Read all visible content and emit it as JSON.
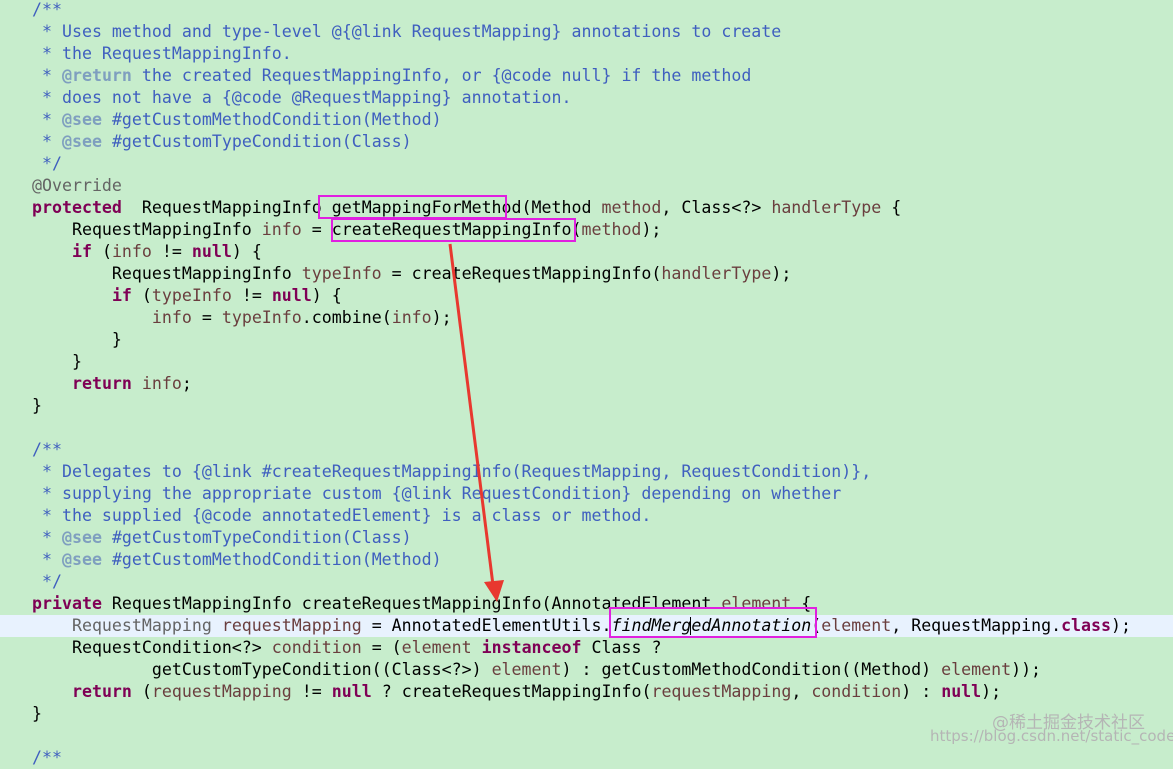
{
  "lines": [
    [
      [
        "c",
        "/**"
      ]
    ],
    [
      [
        "c",
        " * Uses method and type-level @{@link RequestMapping} annotations to create"
      ]
    ],
    [
      [
        "c",
        " * the RequestMappingInfo."
      ]
    ],
    [
      [
        "c",
        " * "
      ],
      [
        "tg",
        "@return"
      ],
      [
        "c",
        " the created RequestMappingInfo, or {@code null} if the method"
      ]
    ],
    [
      [
        "c",
        " * does not have a {@code @RequestMapping} annotation."
      ]
    ],
    [
      [
        "c",
        " * "
      ],
      [
        "tg",
        "@see"
      ],
      [
        "c",
        " #getCustomMethodCondition(Method)"
      ]
    ],
    [
      [
        "c",
        " * "
      ],
      [
        "tg",
        "@see"
      ],
      [
        "c",
        " #getCustomTypeCondition(Class)"
      ]
    ],
    [
      [
        "c",
        " */"
      ]
    ],
    [
      [
        "an",
        "@Override"
      ]
    ],
    [
      [
        "kw",
        "protected"
      ],
      [
        "",
        "  RequestMappingInfo getMappingForMethod(Method "
      ],
      [
        "pm",
        "method"
      ],
      [
        "",
        ", Class<?> "
      ],
      [
        "pm",
        "handlerType"
      ],
      [
        "",
        " {"
      ]
    ],
    [
      [
        "",
        "    RequestMappingInfo "
      ],
      [
        "lv",
        "info"
      ],
      [
        "",
        " = createRequestMappingInfo("
      ],
      [
        "pm",
        "method"
      ],
      [
        "",
        ");"
      ]
    ],
    [
      [
        "",
        "    "
      ],
      [
        "kw",
        "if"
      ],
      [
        "",
        " ("
      ],
      [
        "lv",
        "info"
      ],
      [
        "",
        " != "
      ],
      [
        "kw",
        "null"
      ],
      [
        "",
        ") {"
      ]
    ],
    [
      [
        "",
        "        RequestMappingInfo "
      ],
      [
        "lv",
        "typeInfo"
      ],
      [
        "",
        " = createRequestMappingInfo("
      ],
      [
        "pm",
        "handlerType"
      ],
      [
        "",
        ");"
      ]
    ],
    [
      [
        "",
        "        "
      ],
      [
        "kw",
        "if"
      ],
      [
        "",
        " ("
      ],
      [
        "lv",
        "typeInfo"
      ],
      [
        "",
        " != "
      ],
      [
        "kw",
        "null"
      ],
      [
        "",
        ") {"
      ]
    ],
    [
      [
        "",
        "            "
      ],
      [
        "lv",
        "info"
      ],
      [
        "",
        " = "
      ],
      [
        "lv",
        "typeInfo"
      ],
      [
        "",
        ".combine("
      ],
      [
        "lv",
        "info"
      ],
      [
        "",
        ");"
      ]
    ],
    [
      [
        "",
        "        }"
      ]
    ],
    [
      [
        "",
        "    }"
      ]
    ],
    [
      [
        "",
        "    "
      ],
      [
        "kw",
        "return"
      ],
      [
        "",
        ""
      ],
      [
        "lv",
        " info"
      ],
      [
        "",
        ";"
      ]
    ],
    [
      [
        "",
        "}"
      ]
    ],
    [
      [
        "",
        ""
      ]
    ],
    [
      [
        "c",
        "/**"
      ]
    ],
    [
      [
        "c",
        " * Delegates to {@link #createRequestMappingInfo(RequestMapping, RequestCondition)},"
      ]
    ],
    [
      [
        "c",
        " * supplying the appropriate custom {@link RequestCondition} depending on whether"
      ]
    ],
    [
      [
        "c",
        " * the supplied {@code annotatedElement} is a class or method."
      ]
    ],
    [
      [
        "c",
        " * "
      ],
      [
        "tg",
        "@see"
      ],
      [
        "c",
        " #getCustomTypeCondition(Class)"
      ]
    ],
    [
      [
        "c",
        " * "
      ],
      [
        "tg",
        "@see"
      ],
      [
        "c",
        " #getCustomMethodCondition(Method)"
      ]
    ],
    [
      [
        "c",
        " */"
      ]
    ],
    [
      [
        "kw",
        "private"
      ],
      [
        "",
        " RequestMappingInfo createRequestMappingInfo(AnnotatedElement "
      ],
      [
        "pm",
        "element"
      ],
      [
        "",
        " {"
      ]
    ],
    [
      [
        "an",
        "    RequestMapping "
      ],
      [
        "lv",
        "requestMapping"
      ],
      [
        "",
        " = AnnotatedElementUtils."
      ],
      [
        "it",
        "findMergedAnnotation"
      ],
      [
        "",
        "("
      ],
      [
        "pm",
        "element"
      ],
      [
        "",
        ", RequestMapping."
      ],
      [
        "kw",
        "class"
      ],
      [
        "",
        ");"
      ]
    ],
    [
      [
        "",
        "    RequestCondition<?> "
      ],
      [
        "lv",
        "condition"
      ],
      [
        "",
        " = ("
      ],
      [
        "pm",
        "element"
      ],
      [
        "",
        " "
      ],
      [
        "kw",
        "instanceof"
      ],
      [
        "",
        " Class ?"
      ]
    ],
    [
      [
        "",
        "            getCustomTypeCondition((Class<?>) "
      ],
      [
        "pm",
        "element"
      ],
      [
        "",
        ") : getCustomMethodCondition((Method) "
      ],
      [
        "pm",
        "element"
      ],
      [
        "",
        "));"
      ]
    ],
    [
      [
        "",
        "    "
      ],
      [
        "kw",
        "return"
      ],
      [
        "",
        " ("
      ],
      [
        "lv",
        "requestMapping"
      ],
      [
        "",
        " != "
      ],
      [
        "kw",
        "null"
      ],
      [
        "",
        " ? createRequestMappingInfo("
      ],
      [
        "lv",
        "requestMapping"
      ],
      [
        "",
        ", "
      ],
      [
        "lv",
        "condition"
      ],
      [
        "",
        ") : "
      ],
      [
        "kw",
        "null"
      ],
      [
        "",
        ");"
      ]
    ],
    [
      [
        "",
        "}"
      ]
    ],
    [
      [
        "",
        ""
      ]
    ],
    [
      [
        "c",
        "/**"
      ]
    ]
  ],
  "watermark": {
    "site": "@稀土掘金技术社区",
    "url": "https://blog.csdn.net/static_coder"
  },
  "annotation_colors": {
    "highlight_box": "#e020e0",
    "arrow": "#e8382f"
  }
}
